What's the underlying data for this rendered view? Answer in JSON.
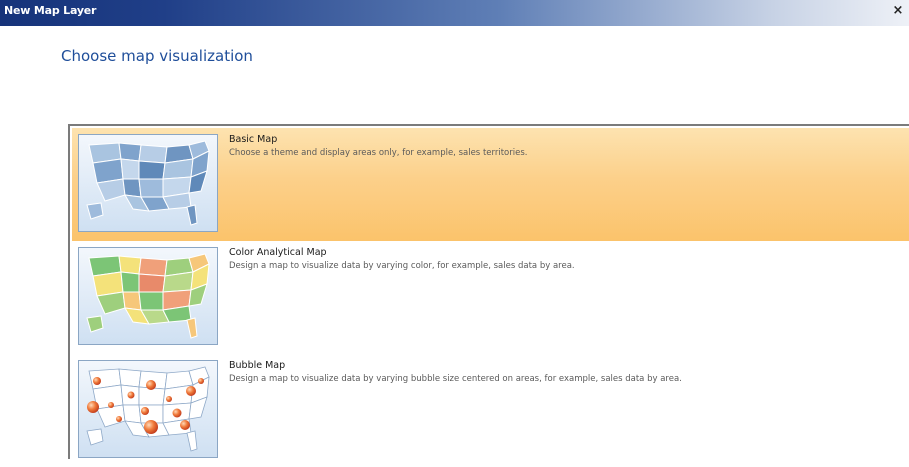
{
  "window": {
    "title": "New Map Layer",
    "close_glyph": "×"
  },
  "page": {
    "heading": "Choose map visualization"
  },
  "options": [
    {
      "title": "Basic Map",
      "description": "Choose a theme and display areas only, for example, sales territories.",
      "icon": "basic-map-icon",
      "selected": true
    },
    {
      "title": "Color Analytical Map",
      "description": "Design a map to visualize data by varying color, for example, sales data by area.",
      "icon": "color-analytical-map-icon",
      "selected": false
    },
    {
      "title": "Bubble Map",
      "description": "Design a map to visualize data by varying bubble size centered on areas, for example, sales data by area.",
      "icon": "bubble-map-icon",
      "selected": false
    }
  ],
  "colors": {
    "selected_background": "#fcd08a",
    "heading": "#1f4e9a",
    "title_bar": "#16337a"
  }
}
